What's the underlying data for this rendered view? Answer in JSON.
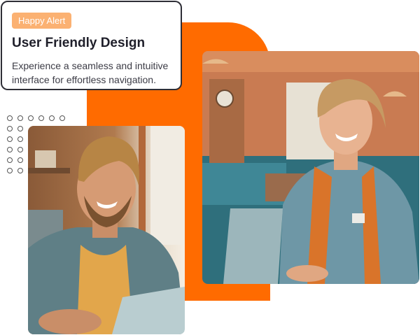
{
  "card": {
    "badge": "Happy Alert",
    "title": "User Friendly Design",
    "description": "Experience a seamless and intuitive interface for effortless navigation."
  },
  "colors": {
    "accent": "#ff6b00",
    "badge_bg": "#fbb172",
    "card_border": "#2e2e36"
  },
  "images": {
    "man": "smiling-man-laptop-photo",
    "woman": "smiling-woman-laptop-cafe-photo"
  }
}
